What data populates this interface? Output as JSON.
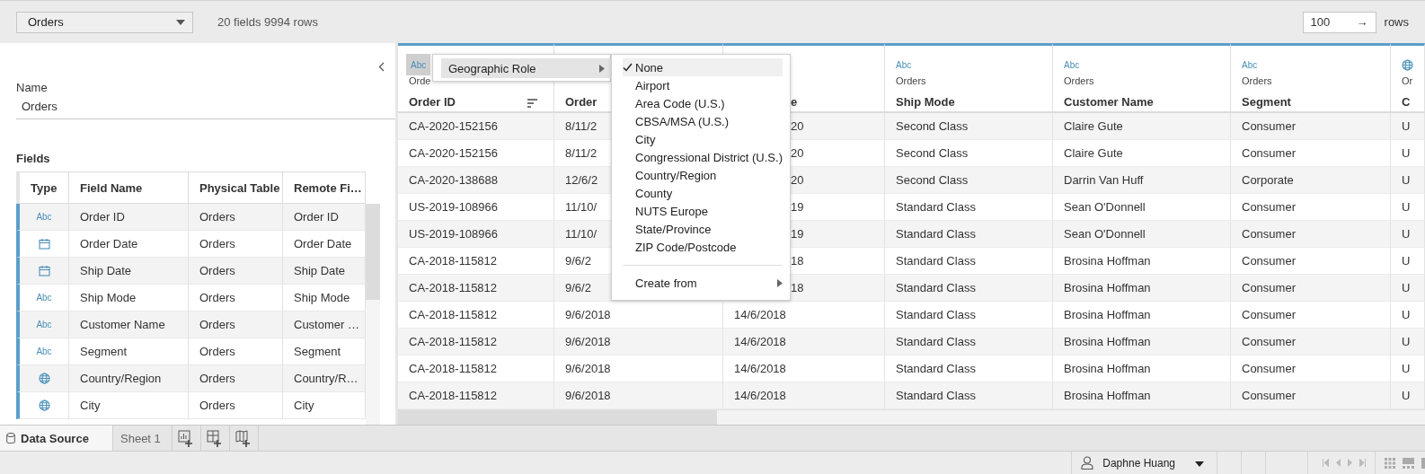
{
  "data_source": {
    "name": "Orders",
    "summary": "20 fields 9994 rows"
  },
  "row_limit": {
    "value": "100",
    "arrow": "→",
    "label": "rows"
  },
  "connection": {
    "name_label": "Name",
    "name_value": "Orders"
  },
  "fields": {
    "title": "Fields",
    "columns": [
      "Type",
      "Field Name",
      "Physical Table",
      "Remote Fi…"
    ],
    "rows": [
      {
        "kind": "string",
        "type_label": "Abc",
        "field_name": "Order ID",
        "physical_table": "Orders",
        "remote_field": "Order ID"
      },
      {
        "kind": "date",
        "field_name": "Order Date",
        "physical_table": "Orders",
        "remote_field": "Order Date"
      },
      {
        "kind": "date",
        "field_name": "Ship Date",
        "physical_table": "Orders",
        "remote_field": "Ship Date"
      },
      {
        "kind": "string",
        "type_label": "Abc",
        "field_name": "Ship Mode",
        "physical_table": "Orders",
        "remote_field": "Ship Mode"
      },
      {
        "kind": "string",
        "type_label": "Abc",
        "field_name": "Customer Name",
        "physical_table": "Orders",
        "remote_field": "Customer …"
      },
      {
        "kind": "string",
        "type_label": "Abc",
        "field_name": "Segment",
        "physical_table": "Orders",
        "remote_field": "Segment"
      },
      {
        "kind": "geo",
        "field_name": "Country/Region",
        "physical_table": "Orders",
        "remote_field": "Country/R…"
      },
      {
        "kind": "geo",
        "field_name": "City",
        "physical_table": "Orders",
        "remote_field": "City"
      }
    ]
  },
  "grid": {
    "columns": [
      {
        "kind": "string",
        "type_label": "Abc",
        "table": "Orde",
        "name": "Order ID",
        "active": true
      },
      {
        "name": "Order"
      },
      {
        "name": "e"
      },
      {
        "kind": "string",
        "type_label": "Abc",
        "table": "Orders",
        "name": "Ship Mode",
        "active": false
      },
      {
        "kind": "string",
        "type_label": "Abc",
        "table": "Orders",
        "name": "Customer Name",
        "active": false
      },
      {
        "kind": "string",
        "type_label": "Abc",
        "table": "Orders",
        "name": "Segment",
        "active": false
      },
      {
        "kind": "geo",
        "table": "Or",
        "name": "C",
        "active": false
      }
    ],
    "rows": [
      [
        "CA-2020-152156",
        "8/11/2",
        "20",
        "Second Class",
        "Claire Gute",
        "Consumer",
        "U"
      ],
      [
        "CA-2020-152156",
        "8/11/2",
        "20",
        "Second Class",
        "Claire Gute",
        "Consumer",
        "U"
      ],
      [
        "CA-2020-138688",
        "12/6/2",
        "20",
        "Second Class",
        "Darrin Van Huff",
        "Corporate",
        "U"
      ],
      [
        "US-2019-108966",
        "11/10/",
        "19",
        "Standard Class",
        "Sean O'Donnell",
        "Consumer",
        "U"
      ],
      [
        "US-2019-108966",
        "11/10/",
        "19",
        "Standard Class",
        "Sean O'Donnell",
        "Consumer",
        "U"
      ],
      [
        "CA-2018-115812",
        "9/6/2",
        "18",
        "Standard Class",
        "Brosina Hoffman",
        "Consumer",
        "U"
      ],
      [
        "CA-2018-115812",
        "9/6/2",
        "18",
        "Standard Class",
        "Brosina Hoffman",
        "Consumer",
        "U"
      ],
      [
        "CA-2018-115812",
        "9/6/2018",
        "14/6/2018",
        "Standard Class",
        "Brosina Hoffman",
        "Consumer",
        "U"
      ],
      [
        "CA-2018-115812",
        "9/6/2018",
        "14/6/2018",
        "Standard Class",
        "Brosina Hoffman",
        "Consumer",
        "U"
      ],
      [
        "CA-2018-115812",
        "9/6/2018",
        "14/6/2018",
        "Standard Class",
        "Brosina Hoffman",
        "Consumer",
        "U"
      ],
      [
        "CA-2018-115812",
        "9/6/2018",
        "14/6/2018",
        "Standard Class",
        "Brosina Hoffman",
        "Consumer",
        "U"
      ]
    ]
  },
  "context_menu": {
    "items": [
      {
        "label": "Geographic Role",
        "selected": true,
        "has_submenu": true
      }
    ]
  },
  "geographic_role_menu": {
    "options": [
      {
        "label": "None",
        "selected": true
      },
      {
        "label": "Airport",
        "selected": false
      },
      {
        "label": "Area Code (U.S.)",
        "selected": false
      },
      {
        "label": "CBSA/MSA (U.S.)",
        "selected": false
      },
      {
        "label": "City",
        "selected": false
      },
      {
        "label": "Congressional District (U.S.)",
        "selected": false
      },
      {
        "label": "Country/Region",
        "selected": false
      },
      {
        "label": "County",
        "selected": false
      },
      {
        "label": "NUTS Europe",
        "selected": false
      },
      {
        "label": "State/Province",
        "selected": false
      },
      {
        "label": "ZIP Code/Postcode",
        "selected": false
      }
    ],
    "actions": [
      {
        "label": "Create from",
        "has_submenu": true
      }
    ]
  },
  "sheet_tabs": [
    {
      "kind": "data_source",
      "label": "Data Source",
      "selected": true
    },
    {
      "kind": "sheet",
      "label": "Sheet 1",
      "selected": false
    }
  ],
  "tab_actions": [
    {
      "kind": "new_worksheet"
    },
    {
      "kind": "new_dashboard"
    },
    {
      "kind": "new_story"
    }
  ],
  "status_bar": {
    "user": "Daphne Huang"
  }
}
